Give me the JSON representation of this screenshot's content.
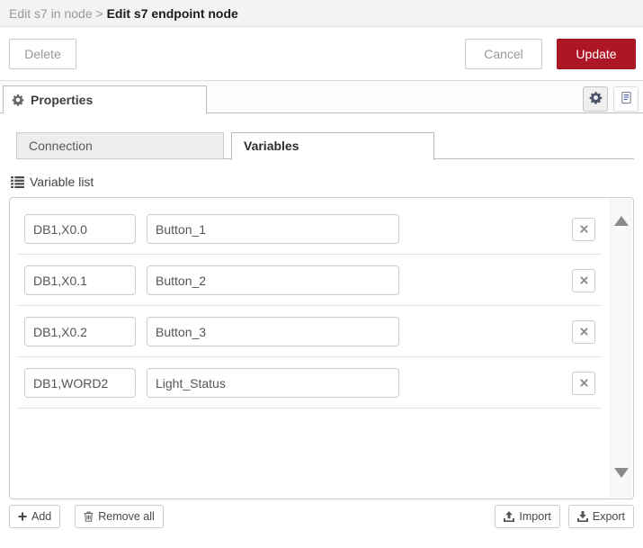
{
  "dialog": {
    "breadcrumb": {
      "parent": "Edit s7 in node",
      "separator": " > ",
      "current": "Edit s7 endpoint node"
    },
    "buttons": {
      "delete": "Delete",
      "cancel": "Cancel",
      "update": "Update"
    }
  },
  "editor_tabs": {
    "properties_label": "Properties"
  },
  "form_tabs": {
    "connection_label": "Connection",
    "variables_label": "Variables"
  },
  "variables": {
    "section_title": "Variable list",
    "rows": [
      {
        "address": "DB1,X0.0",
        "name": "Button_1"
      },
      {
        "address": "DB1,X0.1",
        "name": "Button_2"
      },
      {
        "address": "DB1,X0.2",
        "name": "Button_3"
      },
      {
        "address": "DB1,WORD2",
        "name": "Light_Status"
      }
    ],
    "footer_buttons": {
      "add": "Add",
      "remove_all": "Remove all",
      "import": "Import",
      "export": "Export"
    }
  },
  "icons": {
    "properties_tab": "gear-icon",
    "toolbar_right": [
      "gear-icon",
      "doc-icon"
    ],
    "section": "list-icon",
    "row_remove": "x-icon",
    "add": "plus-icon",
    "remove_all": "trash-icon",
    "import": "upload-icon",
    "export": "download-icon",
    "scrollbar": [
      "triangle-up-icon",
      "triangle-down-icon"
    ]
  },
  "colors": {
    "accent_red": "#ad1625",
    "header_bg": "#f3f3f3",
    "inactive_tab_bg": "#ededed",
    "tab_border": "#bbbbbb",
    "input_border": "#cccccc",
    "muted_text": "#999999",
    "dark_text": "#333333"
  }
}
